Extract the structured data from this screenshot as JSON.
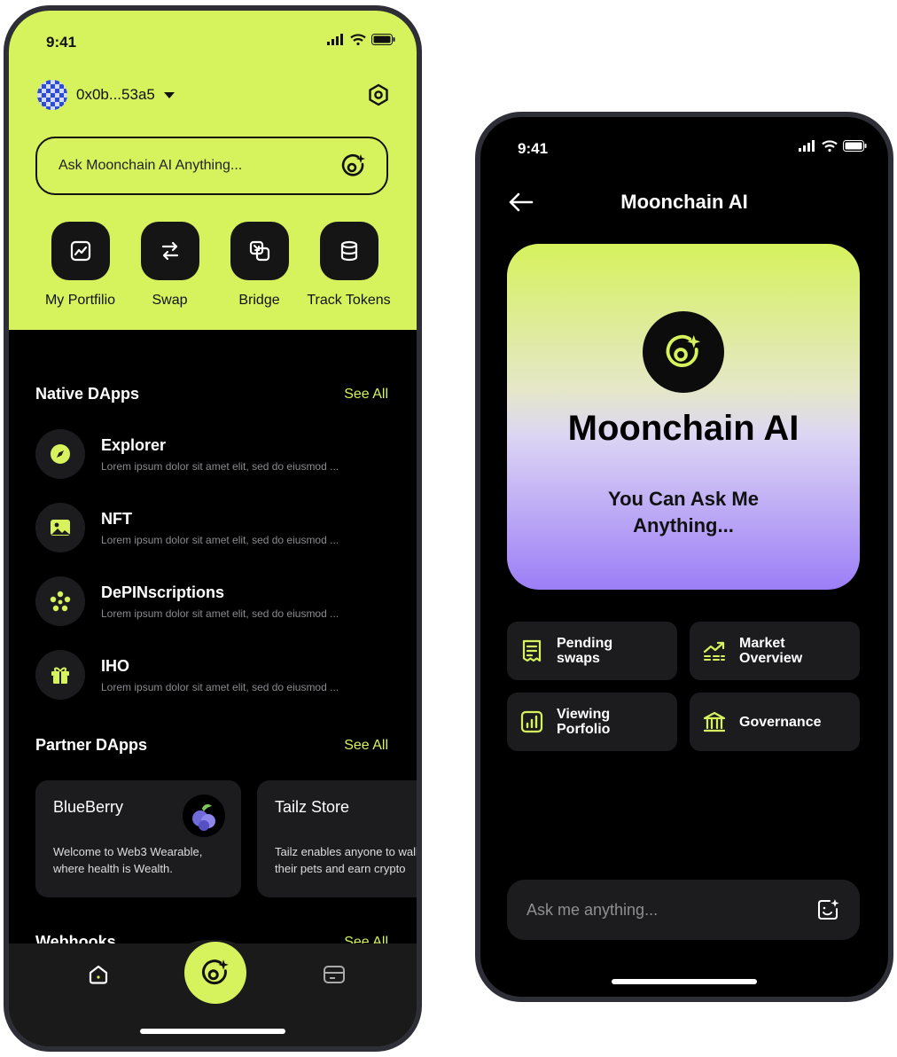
{
  "left_phone": {
    "status": {
      "time": "9:41"
    },
    "header": {
      "wallet_address": "0x0b...53a5"
    },
    "ask_bar": {
      "placeholder": "Ask Moonchain AI Anything..."
    },
    "quick_actions": [
      {
        "label": "My Portfilio",
        "icon": "chart-icon"
      },
      {
        "label": "Swap",
        "icon": "swap-icon"
      },
      {
        "label": "Bridge",
        "icon": "bridge-icon"
      },
      {
        "label": "Track Tokens",
        "icon": "database-icon"
      }
    ],
    "native": {
      "title": "Native DApps",
      "see_all": "See All",
      "items": [
        {
          "name": "Explorer",
          "desc": "Lorem ipsum dolor sit amet elit, sed do eiusmod ..."
        },
        {
          "name": "NFT",
          "desc": "Lorem ipsum dolor sit amet elit, sed do eiusmod ..."
        },
        {
          "name": "DePINscriptions",
          "desc": "Lorem ipsum dolor sit amet elit, sed do eiusmod ..."
        },
        {
          "name": "IHO",
          "desc": "Lorem ipsum dolor sit amet elit, sed do eiusmod ..."
        }
      ]
    },
    "partner": {
      "title": "Partner DApps",
      "see_all": "See All",
      "cards": [
        {
          "name": "BlueBerry",
          "desc": "Welcome to Web3 Wearable, where health is Wealth."
        },
        {
          "name": "Tailz Store",
          "desc": "Tailz enables anyone to walk their pets and earn crypto"
        }
      ]
    },
    "webhooks": {
      "title": "Webhooks",
      "see_all": "See All"
    }
  },
  "right_phone": {
    "status": {
      "time": "9:41"
    },
    "header": {
      "title": "Moonchain AI"
    },
    "hero": {
      "title": "Moonchain AI",
      "subtitle": "You Can Ask Me Anything..."
    },
    "suggestions": [
      {
        "label": "Pending swaps",
        "icon": "receipt-icon"
      },
      {
        "label": "Market Overview",
        "icon": "trend-icon"
      },
      {
        "label": "Viewing Porfolio",
        "icon": "bar-chart-icon"
      },
      {
        "label": "Governance",
        "icon": "bank-icon"
      }
    ],
    "chat": {
      "placeholder": "Ask me anything..."
    }
  },
  "colors": {
    "accent": "#d6f25c",
    "purple": "#9c7ef7",
    "surface": "#1c1c1f",
    "background": "#000000"
  }
}
